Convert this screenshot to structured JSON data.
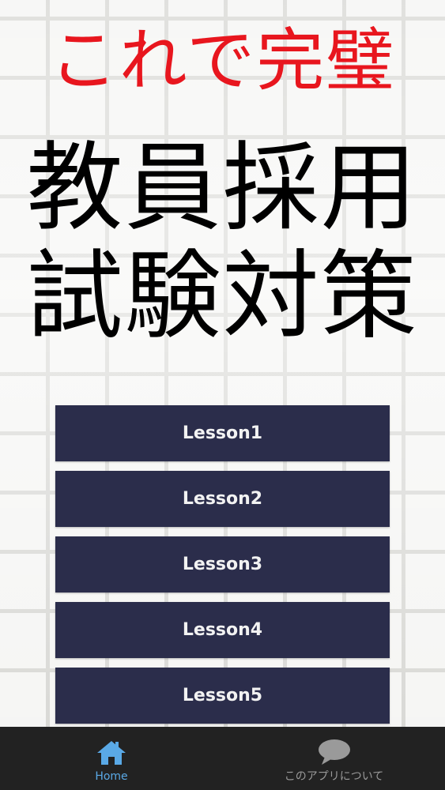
{
  "header": {
    "subtitle": "これで完璧",
    "title_line1": "教員採用",
    "title_line2": "試験対策"
  },
  "lessons": [
    {
      "label": "Lesson1"
    },
    {
      "label": "Lesson2"
    },
    {
      "label": "Lesson3"
    },
    {
      "label": "Lesson4"
    },
    {
      "label": "Lesson5"
    }
  ],
  "bottom_nav": {
    "home": {
      "label": "Home",
      "icon": "home-icon",
      "active": true
    },
    "about": {
      "label": "このアプリについて",
      "icon": "speech-bubble-icon",
      "active": false
    }
  },
  "colors": {
    "subtitle": "#e8161e",
    "title": "#000000",
    "button_bg": "#2b2d4b",
    "button_text": "#f2f2f2",
    "nav_bg": "#222222",
    "nav_active": "#5aa9e6",
    "nav_inactive": "#9a9a9a"
  }
}
